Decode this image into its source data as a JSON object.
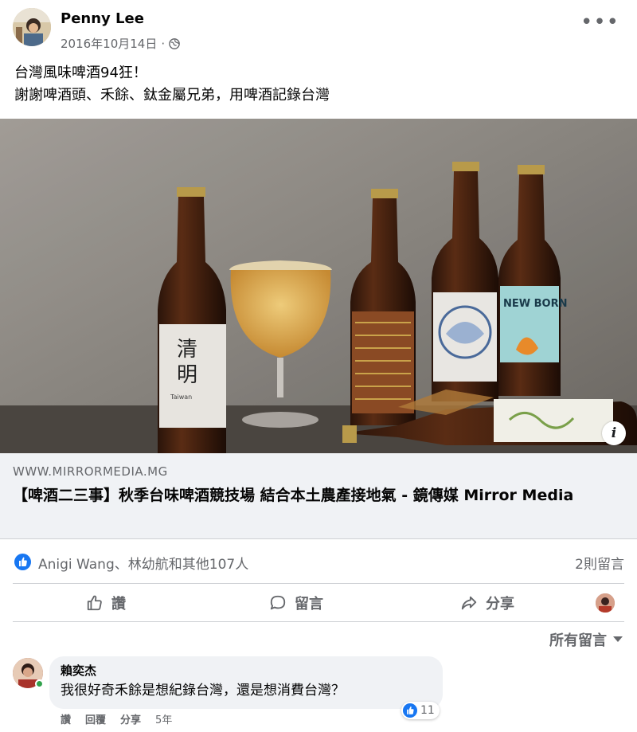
{
  "post": {
    "author": "Penny Lee",
    "date": "2016年10月14日",
    "separator": "·",
    "text_line1": "台灣風味啤酒94狂！",
    "text_line2": "謝謝啤酒頭、禾餘、鈦金屬兄弟，用啤酒記錄台灣",
    "more_icon": "more-horizontal-icon",
    "privacy_icon": "globe-icon"
  },
  "photo": {
    "bottle_label_text": "清\n明",
    "bottle_label_sub": "Taiwan",
    "new_born_label": "NEW BORN",
    "info_label": "i"
  },
  "link": {
    "domain": "WWW.MIRRORMEDIA.MG",
    "title": "【啤酒二三事】秋季台味啤酒競技場 結合本土農產接地氣 - 鏡傳媒 Mirror Media"
  },
  "reactions": {
    "names": "Anigi Wang、林幼航和其他107人",
    "comments": "2則留言"
  },
  "actions": {
    "like": "讚",
    "comment": "留言",
    "share": "分享"
  },
  "filter": {
    "label": "所有留言"
  },
  "comment": {
    "name": "賴奕杰",
    "text": "我很好奇禾餘是想紀錄台灣，還是想消費台灣？",
    "reaction_count": "11",
    "like": "讚",
    "reply": "回覆",
    "share": "分享",
    "age": "5年"
  },
  "colors": {
    "accent": "#1877f2",
    "secondary_text": "#65676b",
    "card_bg": "#f0f2f5"
  }
}
